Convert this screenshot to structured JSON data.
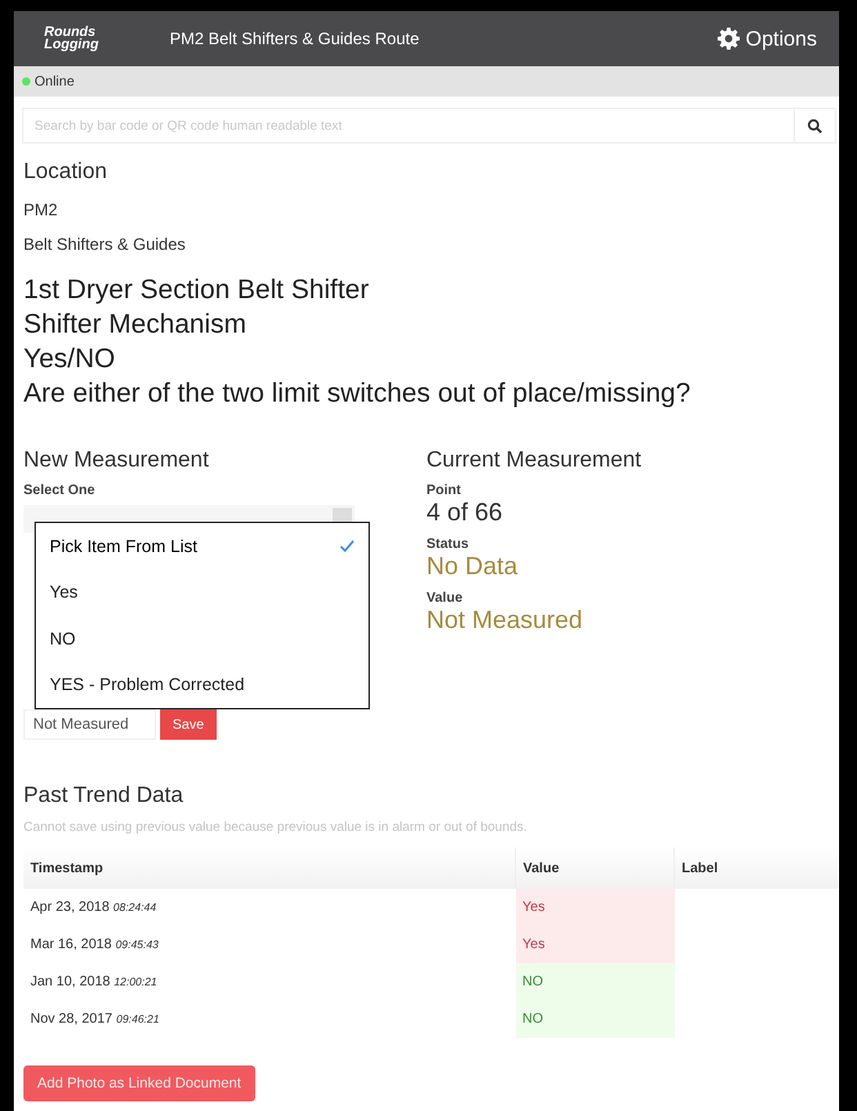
{
  "header": {
    "logo": [
      "Rounds",
      "Logging"
    ],
    "title": "PM2 Belt Shifters & Guides Route",
    "options": "Options"
  },
  "status_bar": {
    "text": "Online",
    "online": true
  },
  "search": {
    "placeholder": "Search by bar code or QR code human readable text"
  },
  "location": {
    "heading": "Location",
    "lines": [
      "PM2",
      "Belt Shifters & Guides"
    ]
  },
  "titles": [
    "1st Dryer Section Belt Shifter",
    "Shifter Mechanism",
    "Yes/NO",
    "Are either of the two limit switches out of place/missing?"
  ],
  "new_measurement": {
    "heading": "New Measurement",
    "select_label": "Select One",
    "value_field": "Not Measured",
    "save": "Save"
  },
  "dropdown": {
    "options": [
      {
        "label": "Pick Item From List",
        "selected": true
      },
      {
        "label": "Yes",
        "selected": false
      },
      {
        "label": "NO",
        "selected": false
      },
      {
        "label": "YES - Problem Corrected",
        "selected": false
      }
    ]
  },
  "current_measurement": {
    "heading": "Current Measurement",
    "fields": [
      {
        "label": "Point",
        "value": "4 of 66",
        "kind": "plain"
      },
      {
        "label": "Status",
        "value": "No Data",
        "kind": "warn"
      },
      {
        "label": "Value",
        "value": "Not Measured",
        "kind": "warn"
      }
    ]
  },
  "past_trend": {
    "heading": "Past Trend Data",
    "note": "Cannot save using previous value because previous value is in alarm or out of bounds.",
    "columns": [
      "Timestamp",
      "Value",
      "Label"
    ],
    "rows": [
      {
        "date": "Apr 23, 2018",
        "time": "08:24:44",
        "value": "Yes",
        "alarm": true
      },
      {
        "date": "Mar 16, 2018",
        "time": "09:45:43",
        "value": "Yes",
        "alarm": true
      },
      {
        "date": "Jan 10, 2018",
        "time": "12:00:21",
        "value": "NO",
        "alarm": false
      },
      {
        "date": "Nov 28, 2017",
        "time": "09:46:21",
        "value": "NO",
        "alarm": false
      }
    ]
  },
  "add_photo_button": "Add Photo as Linked Document"
}
